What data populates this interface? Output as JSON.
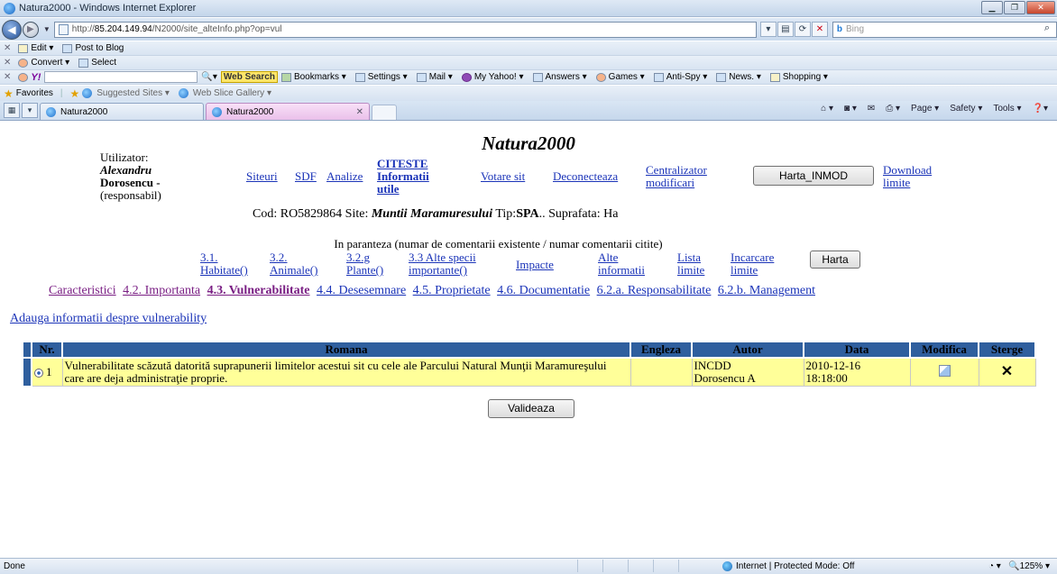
{
  "window": {
    "title": "Natura2000 - Windows Internet Explorer"
  },
  "address": {
    "url_scheme": "http://",
    "url_host": "85.204.149.94",
    "url_path": "/N2000/site_alteInfo.php?op=vul",
    "search_placeholder": "Bing",
    "search_brand": "b"
  },
  "command_rows": {
    "row1": {
      "edit": "Edit",
      "post": "Post to Blog"
    },
    "row2": {
      "convert": "Convert",
      "select": "Select"
    },
    "row3": {
      "web_search": "Web Search",
      "items": [
        "Bookmarks ▾",
        "Settings ▾",
        "Mail ▾",
        "My Yahoo! ▾",
        "Answers ▾",
        "Games ▾",
        "Anti-Spy ▾",
        "News. ▾",
        "Shopping ▾"
      ]
    }
  },
  "favorites": {
    "label": "Favorites",
    "items": [
      "Suggested Sites ▾",
      "Web Slice Gallery ▾"
    ]
  },
  "tabs": [
    {
      "label": "Natura2000"
    },
    {
      "label": "Natura2000"
    }
  ],
  "tools": [
    "Page ▾",
    "Safety ▾",
    "Tools ▾"
  ],
  "page": {
    "title": "Natura2000",
    "user": {
      "label": "Utilizator:",
      "first": "Alexandru",
      "last": "Dorosencu -",
      "role": "(responsabil)"
    },
    "nav": {
      "siteuri": "Siteuri",
      "sdf": "SDF",
      "analize": "Analize",
      "citeste1": "CITESTE",
      "citeste2": "Informatii",
      "citeste3": "utile",
      "votare": "Votare  sit",
      "deconecteaza": "Deconecteaza",
      "centralizator1": "Centralizator",
      "centralizator2": "modificari",
      "harta_inmod": "Harta_INMOD",
      "download1": "Download",
      "download2": "limite"
    },
    "cod": {
      "prefix": "Cod: RO5829864 Site: ",
      "site": "Muntii Maramuresului",
      "tip_label": " Tip:",
      "tip": "SPA",
      "suffix": ".. Suprafata: Ha"
    },
    "paren_text": "In paranteza (numar de comentarii existente / numar comentarii citite)",
    "subnav": {
      "habitate1": "3.1.",
      "habitate2": "Habitate()",
      "animale1": "3.2.",
      "animale2": "Animale()",
      "plante1": "3.2.g",
      "plante2": "Plante()",
      "specii1": "3.3 Alte specii",
      "specii2": "importante()",
      "impacte": "Impacte",
      "alte1": "Alte",
      "alte2": "informatii",
      "lista1": "Lista",
      "lista2": "limite",
      "incarcare1": "Incarcare",
      "incarcare2": "limite",
      "harta": "Harta"
    },
    "sections": [
      {
        "label": "Caracteristici",
        "state": "visited"
      },
      {
        "label": "4.2. Importanta",
        "state": "visited"
      },
      {
        "label": "4.3. Vulnerabilitate",
        "state": "current"
      },
      {
        "label": "4.4. Desesemnare",
        "state": "normal"
      },
      {
        "label": "4.5. Proprietate",
        "state": "normal"
      },
      {
        "label": "4.6. Documentatie",
        "state": "normal"
      },
      {
        "label": "6.2.a. Responsabilitate",
        "state": "normal"
      },
      {
        "label": "6.2.b. Management",
        "state": "normal"
      }
    ],
    "add_info": "Adauga informatii despre vulnerability",
    "table": {
      "headers": {
        "nr": "Nr.",
        "romana": "Romana",
        "engleza": "Engleza",
        "autor": "Autor",
        "data": "Data",
        "modifica": "Modifica",
        "sterge": "Sterge"
      },
      "rows": [
        {
          "nr": "1",
          "romana": "Vulnerabilitate scăzută datorită suprapunerii limitelor acestui sit cu cele ale Parcului Natural Munţii Maramureşului care are deja administraţie proprie.",
          "engleza": "",
          "autor1": "INCDD",
          "autor2": "Dorosencu A",
          "data1": "2010-12-16",
          "data2": "18:18:00"
        }
      ]
    },
    "validate_button": "Valideaza"
  },
  "status": {
    "text": "Done",
    "zone": "Internet | Protected Mode: Off",
    "zoom": "125%"
  }
}
